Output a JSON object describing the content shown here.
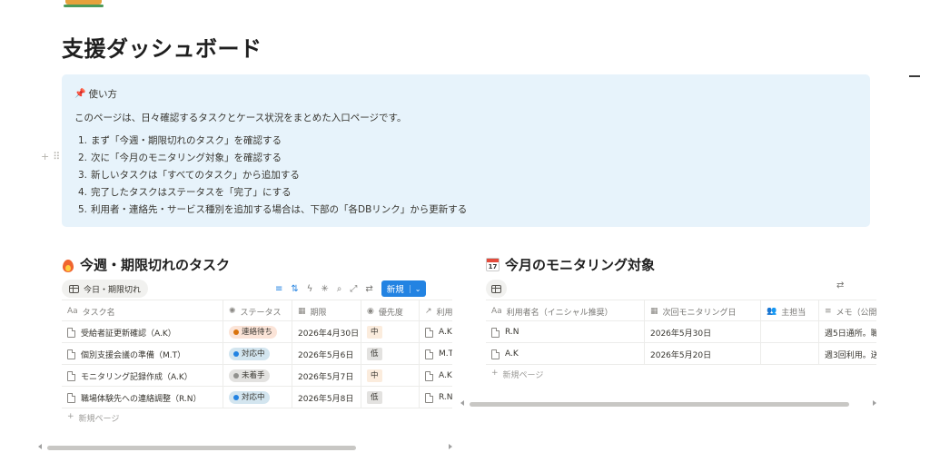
{
  "page": {
    "title": "支援ダッシュボード"
  },
  "callout": {
    "heading": "使い方",
    "intro": "このページは、日々確認するタスクとケース状況をまとめた入口ページです。",
    "steps": [
      {
        "num": "1.",
        "text": "まず「今週・期限切れのタスク」を確認する"
      },
      {
        "num": "2.",
        "text": "次に「今月のモニタリング対象」を確認する"
      },
      {
        "num": "3.",
        "text": "新しいタスクは「すべてのタスク」から追加する"
      },
      {
        "num": "4.",
        "text": "完了したタスクはステータスを「完了」にする"
      },
      {
        "num": "5.",
        "text": "利用者・連絡先・サービス種別を追加する場合は、下部の「各DBリンク」から更新する"
      }
    ]
  },
  "tasks": {
    "heading": "今週・期限切れのタスク",
    "view_tab": "今日・期限切れ",
    "new_button": "新規",
    "columns": [
      "タスク名",
      "ステータス",
      "期限",
      "優先度",
      "利用"
    ],
    "rows": [
      {
        "name": "受給者証更新確認（A.K）",
        "status": "連絡待ち",
        "due": "2026年4月30日",
        "priority": "中",
        "user": "A.K"
      },
      {
        "name": "個別支援会議の準備（M.T）",
        "status": "対応中",
        "due": "2026年5月6日",
        "priority": "低",
        "user": "M.T"
      },
      {
        "name": "モニタリング記録作成（A.K）",
        "status": "未着手",
        "due": "2026年5月7日",
        "priority": "中",
        "user": "A.K"
      },
      {
        "name": "職場体験先への連絡調整（R.N）",
        "status": "対応中",
        "due": "2026年5月8日",
        "priority": "低",
        "user": "R.N"
      }
    ],
    "new_page": "新規ページ"
  },
  "monitoring": {
    "heading": "今月のモニタリング対象",
    "columns": [
      "利用者名（イニシャル推奨）",
      "次回モニタリング日",
      "主担当",
      "メモ（公開"
    ],
    "rows": [
      {
        "name": "R.N",
        "date": "2026年5月30日",
        "owner": "",
        "memo": "週5日通所。職"
      },
      {
        "name": "A.K",
        "date": "2026年5月20日",
        "owner": "",
        "memo": "週3回利用。送"
      }
    ],
    "new_page": "新規ページ"
  },
  "colors": {
    "callout_bg": "#e7f3fb",
    "accent": "#2383e2",
    "status_waiting_bg": "#fbe4d8",
    "status_waiting_dot": "#d9730d",
    "status_active_bg": "#d3e5ef",
    "status_active_dot": "#2383e2",
    "status_todo_bg": "#e3e2e0",
    "status_todo_dot": "#91918e",
    "priority_mid_bg": "#fbecdd",
    "priority_low_bg": "#e3e2e0"
  },
  "icons": {
    "page": "house-icon",
    "callout": "pushpin-icon",
    "tasks": "fire-icon",
    "monitoring": "calendar-icon"
  }
}
